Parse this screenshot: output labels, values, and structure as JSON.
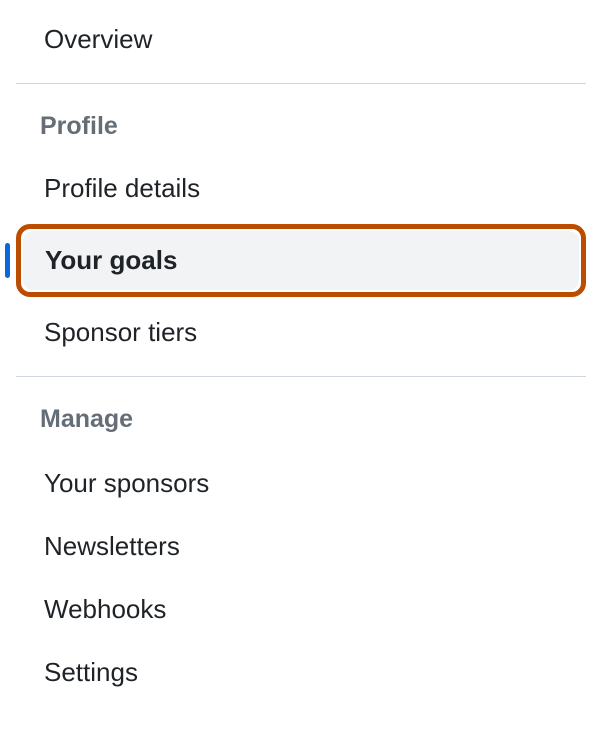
{
  "nav": {
    "overview": "Overview",
    "sections": [
      {
        "header": "Profile",
        "items": [
          {
            "label": "Profile details",
            "active": false
          },
          {
            "label": "Your goals",
            "active": true
          },
          {
            "label": "Sponsor tiers",
            "active": false
          }
        ]
      },
      {
        "header": "Manage",
        "items": [
          {
            "label": "Your sponsors",
            "active": false
          },
          {
            "label": "Newsletters",
            "active": false
          },
          {
            "label": "Webhooks",
            "active": false
          },
          {
            "label": "Settings",
            "active": false
          }
        ]
      }
    ]
  }
}
